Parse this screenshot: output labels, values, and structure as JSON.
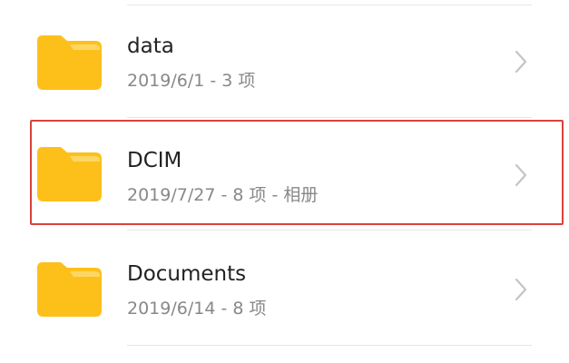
{
  "folders": [
    {
      "name": "data",
      "meta": "2019/6/1 - 3 项",
      "icon": "folder-icon"
    },
    {
      "name": "DCIM",
      "meta": "2019/7/27 - 8 项 - 相册",
      "icon": "folder-icon"
    },
    {
      "name": "Documents",
      "meta": "2019/6/14 - 8 项",
      "icon": "folder-icon"
    }
  ],
  "colors": {
    "folder": "#FDC01A",
    "folder_tab_light": "#FDD763",
    "highlight": "#D9433B",
    "primary_text": "#222222",
    "secondary_text": "#888888",
    "chevron": "#C4C4C4",
    "divider": "#E6E6E6"
  },
  "icons": {
    "chevron": "chevron-right-icon"
  }
}
